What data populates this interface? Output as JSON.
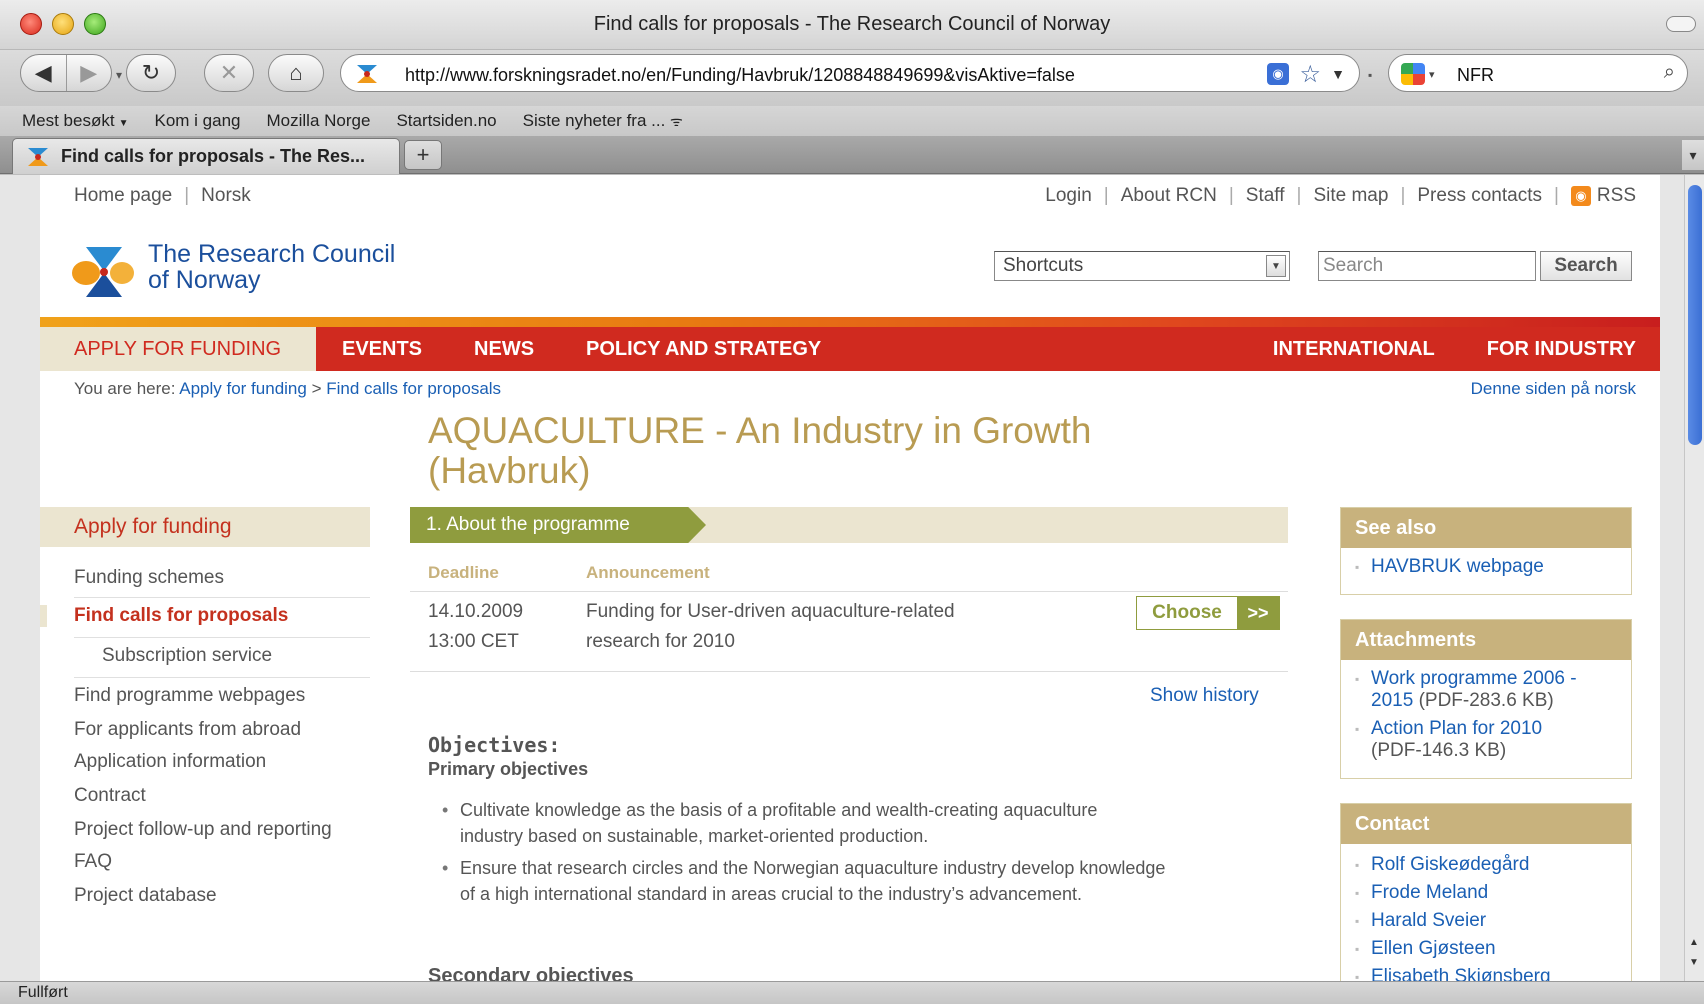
{
  "window": {
    "title": "Find calls for proposals - The Research Council of Norway"
  },
  "toolbar": {
    "url": "http://www.forskningsradet.no/en/Funding/Havbruk/1208848849699&visAktive=false",
    "search_query": "NFR"
  },
  "bookmarks": [
    "Mest besøkt",
    "Kom i gang",
    "Mozilla Norge",
    "Startsiden.no",
    "Siste nyheter fra ..."
  ],
  "tab": {
    "label": "Find calls for proposals - The Res..."
  },
  "status": "Fullført",
  "util": {
    "left": [
      "Home page",
      "Norsk"
    ],
    "right": [
      "Login",
      "About RCN",
      "Staff",
      "Site map",
      "Press contacts"
    ],
    "rss": "RSS"
  },
  "logo": {
    "line1": "The Research Council",
    "line2": "of Norway"
  },
  "header": {
    "shortcuts": "Shortcuts",
    "search_placeholder": "Search",
    "search_button": "Search"
  },
  "mainnav": {
    "active": "APPLY FOR FUNDING",
    "items": [
      "EVENTS",
      "NEWS",
      "POLICY AND STRATEGY"
    ],
    "right": [
      "INTERNATIONAL",
      "FOR INDUSTRY"
    ]
  },
  "breadcrumb": {
    "prefix": "You are here:",
    "items": [
      "Apply for funding",
      "Find calls for proposals"
    ],
    "separator": ">"
  },
  "norsk_link": "Denne siden på norsk",
  "page_title": "AQUACULTURE - An Industry in Growth (Havbruk)",
  "leftnav": {
    "heading": "Apply for funding",
    "items": [
      "Funding schemes",
      "Find calls for proposals",
      "Subscription service",
      "Find programme webpages",
      "For applicants from abroad",
      "Application information",
      "Contract",
      "Project follow-up and reporting",
      "FAQ",
      "Project database"
    ]
  },
  "programme": {
    "step": "1. About the programme",
    "col_deadline": "Deadline",
    "col_announcement": "Announcement",
    "deadline_date": "14.10.2009",
    "deadline_time": "13:00 CET",
    "announcement_l1": "Funding for User-driven aquaculture-related",
    "announcement_l2": "research for 2010",
    "choose": "Choose",
    "choose_arrow": ">>",
    "show_history": "Show history",
    "objectives": "Objectives:",
    "primary": "Primary objectives",
    "bullet1_l1": "Cultivate knowledge as the basis of a profitable and wealth-creating aquaculture",
    "bullet1_l2": "industry based on sustainable, market-oriented production.",
    "bullet2_l1": "Ensure that research circles and the Norwegian aquaculture industry develop knowledge",
    "bullet2_l2": "of a high international standard in areas crucial to the industry’s advancement.",
    "secondary_cut": "Secondary objectives"
  },
  "see_also": {
    "heading": "See also",
    "items": [
      "HAVBRUK webpage"
    ]
  },
  "attachments": {
    "heading": "Attachments",
    "a1_l1": "Work programme 2006 -",
    "a1_l2": "2015",
    "a1_meta": "(PDF-283.6 KB)",
    "a2_l1": "Action Plan for 2010",
    "a2_meta": "(PDF-146.3 KB)"
  },
  "contact": {
    "heading": "Contact",
    "items": [
      "Rolf Giskeødegård",
      "Frode Meland",
      "Harald Sveier",
      "Ellen Gjøsteen",
      "Elisabeth Skjønsberg"
    ]
  }
}
